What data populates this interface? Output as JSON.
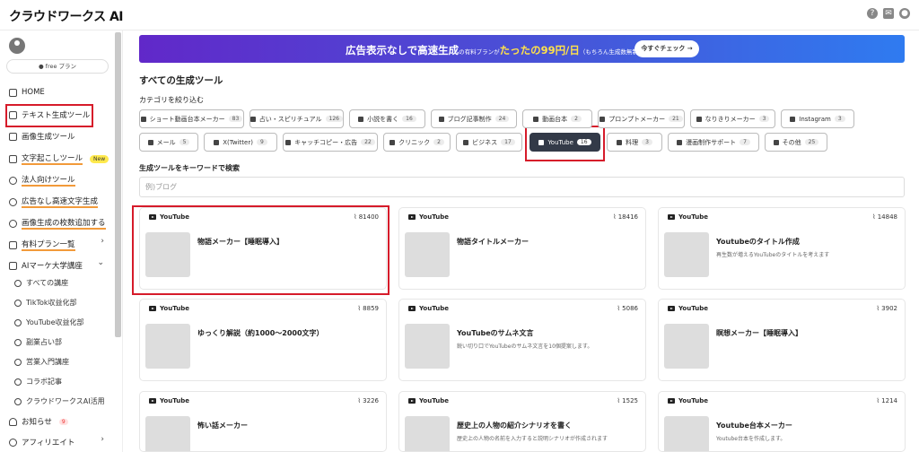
{
  "app": {
    "logo": "クラウドワークス AI"
  },
  "topbar": {
    "help_icon": "?",
    "mail_icon": "✉",
    "user_icon": "●"
  },
  "sidebar": {
    "plan": "● free プラン",
    "items": [
      {
        "label": "HOME",
        "icon": "home-icon"
      },
      {
        "label": "テキスト生成ツール",
        "icon": "pen-icon"
      },
      {
        "label": "画像生成ツール",
        "icon": "image-icon"
      },
      {
        "label": "文字起こしツール",
        "icon": "mic-icon",
        "badge": "New"
      },
      {
        "label": "法人向けツール",
        "icon": "check-circle-icon"
      },
      {
        "label": "広告なし高速文字生成",
        "icon": "check-circle-icon"
      },
      {
        "label": "画像生成の枚数追加する",
        "icon": "check-circle-icon"
      },
      {
        "label": "有料プラン一覧",
        "icon": "crown-icon"
      },
      {
        "label": "AIマーケ大学講座",
        "icon": "book-icon"
      }
    ],
    "sub_items": [
      "すべての講座",
      "TikTok収益化部",
      "YouTube収益化部",
      "副業占い部",
      "営業入門講座",
      "コラボ記事",
      "クラウドワークスAI活用"
    ],
    "notice": {
      "label": "お知らせ",
      "count": "9"
    },
    "affiliate": {
      "label": "アフィリエイト"
    }
  },
  "banner": {
    "pre": "広告表示なしで",
    "big": "高速生成",
    "mid": "の有料プランが",
    "hl": "たったの99円/日",
    "small": "（もちろん生成数無制限）",
    "button": "今すぐチェック →"
  },
  "main": {
    "heading": "すべての生成ツール",
    "category_label": "カテゴリを絞り込む",
    "search_label": "生成ツールをキーワードで検索",
    "search_placeholder": "例)ブログ"
  },
  "categories": [
    {
      "label": "ショート動画台本メーカー",
      "count": "83"
    },
    {
      "label": "占い・スピリチュアル",
      "count": "126"
    },
    {
      "label": "小説を書く",
      "count": "16"
    },
    {
      "label": "ブログ記事制作",
      "count": "24"
    },
    {
      "label": "動画台本",
      "count": "2"
    },
    {
      "label": "プロンプトメーカー",
      "count": "21"
    },
    {
      "label": "なりきりメーカー",
      "count": "3"
    },
    {
      "label": "Instagram",
      "count": "3"
    },
    {
      "label": "メール",
      "count": "5"
    },
    {
      "label": "X(Twitter)",
      "count": "9"
    },
    {
      "label": "キャッチコピー・広告",
      "count": "22"
    },
    {
      "label": "クリニック",
      "count": "2"
    },
    {
      "label": "ビジネス",
      "count": "17"
    },
    {
      "label": "YouTube",
      "count": "16",
      "active": true
    },
    {
      "label": "料理",
      "count": "3"
    },
    {
      "label": "漫画制作サポート",
      "count": "7"
    },
    {
      "label": "その他",
      "count": "25"
    }
  ],
  "cards": [
    {
      "category": "YouTube",
      "views": "81400",
      "title": "物語メーカー【睡眠導入】",
      "desc": ""
    },
    {
      "category": "YouTube",
      "views": "18416",
      "title": "物語タイトルメーカー",
      "desc": ""
    },
    {
      "category": "YouTube",
      "views": "14848",
      "title": "Youtubeのタイトル作成",
      "desc": "再生数が増えるYouTubeのタイトルを考えます"
    },
    {
      "category": "YouTube",
      "views": "8859",
      "title": "ゆっくり解説（約1000～2000文字）",
      "desc": ""
    },
    {
      "category": "YouTube",
      "views": "5086",
      "title": "YouTubeのサムネ文言",
      "desc": "鋭い切り口でYouTubeのサムネ文言を10個提案します。"
    },
    {
      "category": "YouTube",
      "views": "3902",
      "title": "瞑想メーカー【睡眠導入】",
      "desc": ""
    },
    {
      "category": "YouTube",
      "views": "3226",
      "title": "怖い話メーカー",
      "desc": ""
    },
    {
      "category": "YouTube",
      "views": "1525",
      "title": "歴史上の人物の紹介シナリオを書く",
      "desc": "歴史上の人物の名前を入力すると説明シナリオが作成されます"
    },
    {
      "category": "YouTube",
      "views": "1214",
      "title": "Youtube台本メーカー",
      "desc": "Youtube台本を作成します。"
    }
  ]
}
